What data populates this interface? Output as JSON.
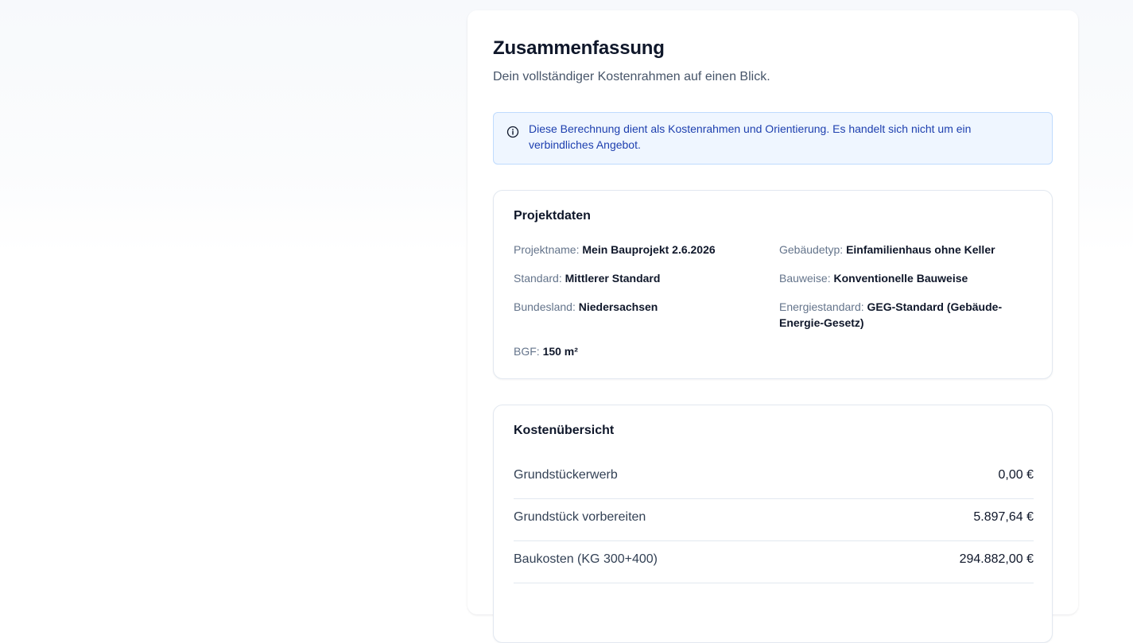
{
  "summary": {
    "title": "Zusammenfassung",
    "subtitle": "Dein vollständiger Kostenrahmen auf einen Blick.",
    "info_text": "Diese Berechnung dient als Kostenrahmen und Orientierung. Es handelt sich nicht um ein verbindliches Angebot.",
    "info_icon": "info-circle-icon"
  },
  "project": {
    "title": "Projektdaten",
    "fields": [
      {
        "label": "Projektname:",
        "value": "Mein Bauprojekt 2.6.2026"
      },
      {
        "label": "Gebäudetyp:",
        "value": "Einfamilienhaus ohne Keller"
      },
      {
        "label": "Standard:",
        "value": "Mittlerer Standard"
      },
      {
        "label": "Bauweise:",
        "value": "Konventionelle Bauweise"
      },
      {
        "label": "Bundesland:",
        "value": "Niedersachsen"
      },
      {
        "label": "Energiestandard:",
        "value": "GEG-Standard (Gebäude-Energie-Gesetz)"
      },
      {
        "label": "BGF:",
        "value": "150 m²"
      }
    ]
  },
  "costs": {
    "title": "Kostenübersicht",
    "rows": [
      {
        "label": "Grundstückerwerb",
        "value": "0,00 €"
      },
      {
        "label": "Grundstück vorbereiten",
        "value": "5.897,64 €"
      },
      {
        "label": "Baukosten (KG 300+400)",
        "value": "294.882,00 €"
      }
    ]
  },
  "colors": {
    "accent_text": "#1e40af",
    "info_background": "#eff6ff",
    "info_border": "#bfdbfe"
  }
}
